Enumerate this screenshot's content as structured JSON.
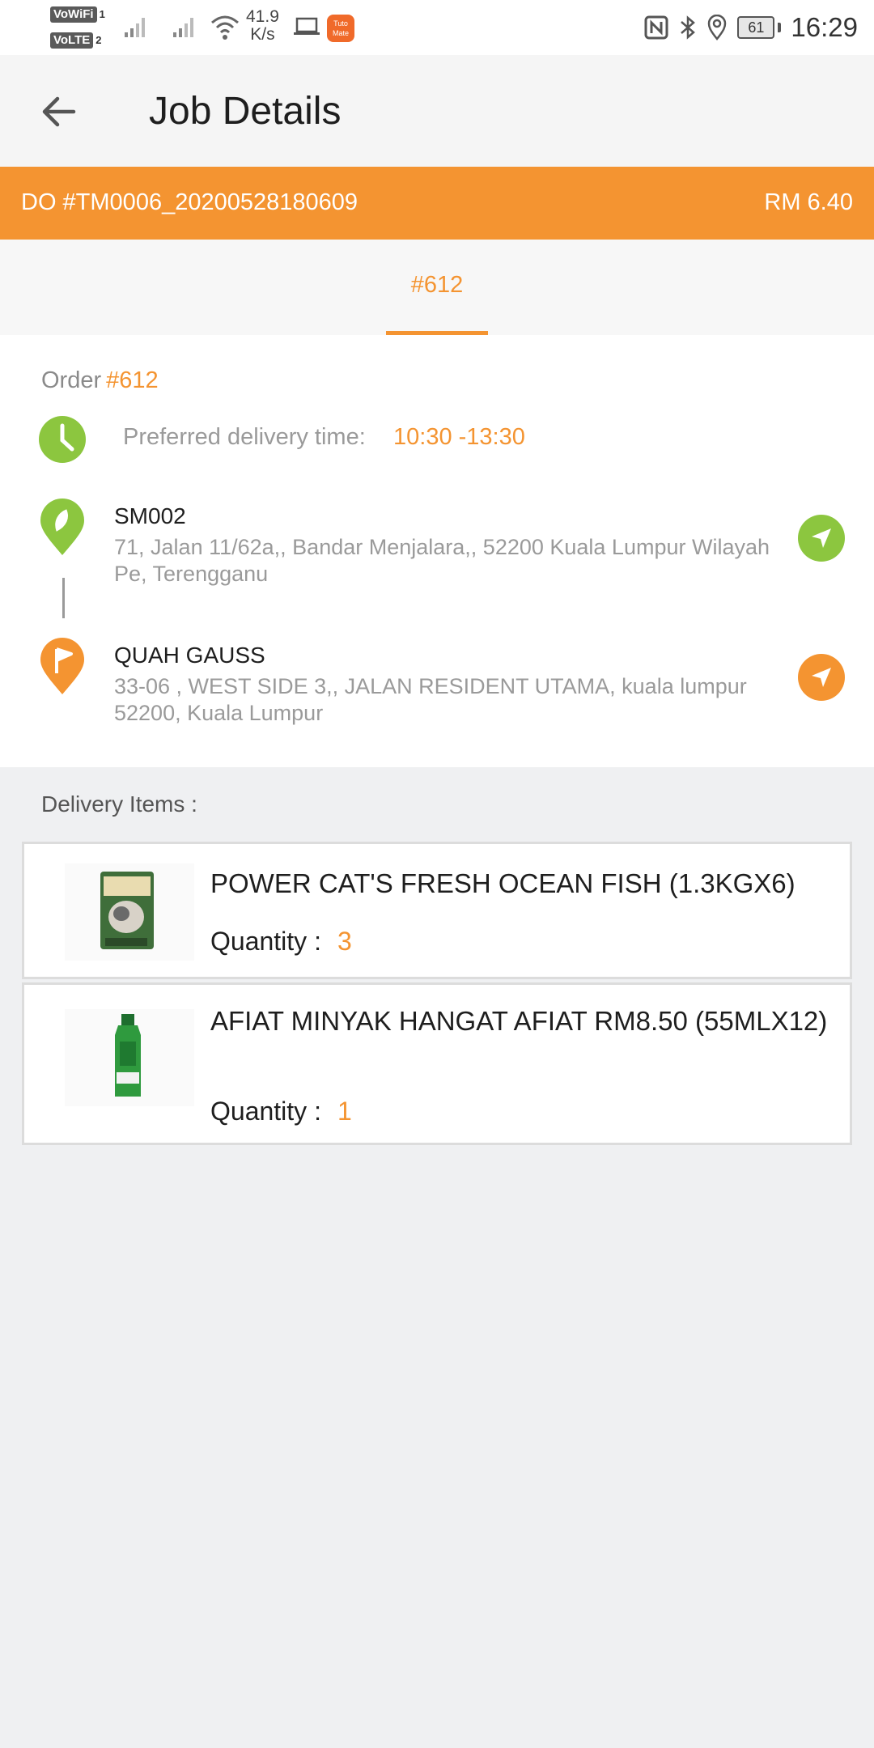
{
  "status_bar": {
    "net1": "VoWiFi",
    "net1_sub": "1",
    "net2": "VoLTE",
    "net2_sub": "2",
    "speed_value": "41.9",
    "speed_unit": "K/s",
    "app_badge": "Tuto Mate",
    "battery": "61",
    "time": "16:29"
  },
  "app_bar": {
    "title": "Job Details",
    "back_icon": "arrow-left-icon"
  },
  "banner": {
    "do_number": "DO #TM0006_20200528180609",
    "price": "RM 6.40",
    "color": "#f49431"
  },
  "tabs": [
    {
      "label": "#612",
      "selected": true
    }
  ],
  "order": {
    "label": "Order",
    "number": "#612",
    "time_label": "Preferred delivery time:",
    "time_value": "10:30 -13:30",
    "stops": [
      {
        "type": "pickup",
        "name": "SM002",
        "address": "71, Jalan 11/62a,, Bandar Menjalara,, 52200 Kuala Lumpur Wilayah Pe, Terengganu",
        "color": "#8cc63f"
      },
      {
        "type": "dropoff",
        "name": "QUAH GAUSS",
        "address": "33-06 , WEST SIDE 3,, JALAN RESIDENT UTAMA, kuala lumpur 52200, Kuala Lumpur",
        "color": "#f49431"
      }
    ]
  },
  "delivery_items": {
    "heading": "Delivery Items :",
    "quantity_label": "Quantity :",
    "items": [
      {
        "name": "POWER CAT'S FRESH OCEAN FISH (1.3KGX6)",
        "quantity": "3"
      },
      {
        "name": "AFIAT MINYAK HANGAT AFIAT RM8.50 (55MLX12)",
        "quantity": "1"
      }
    ]
  }
}
